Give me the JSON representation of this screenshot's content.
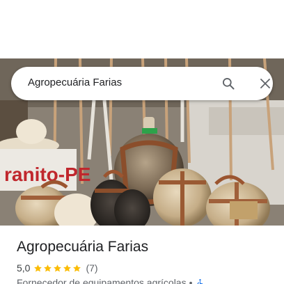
{
  "search": {
    "query": "Agropecuária Farias"
  },
  "place": {
    "name": "Agropecuária Farias",
    "rating": "5,0",
    "rating_stars": 5,
    "reviews": "(7)",
    "category": "Fornecedor de equipamentos agrícolas",
    "separator": "•"
  },
  "photo": {
    "sign_text": "ranito-PE"
  },
  "icons": {
    "search": "search-icon",
    "close": "close-icon",
    "star": "star-icon",
    "accessibility": "wheelchair-accessible-icon"
  },
  "colors": {
    "star": "#fbbc04",
    "accessibility": "#1a73e8",
    "text_primary": "#202124",
    "text_secondary": "#5f6368"
  }
}
